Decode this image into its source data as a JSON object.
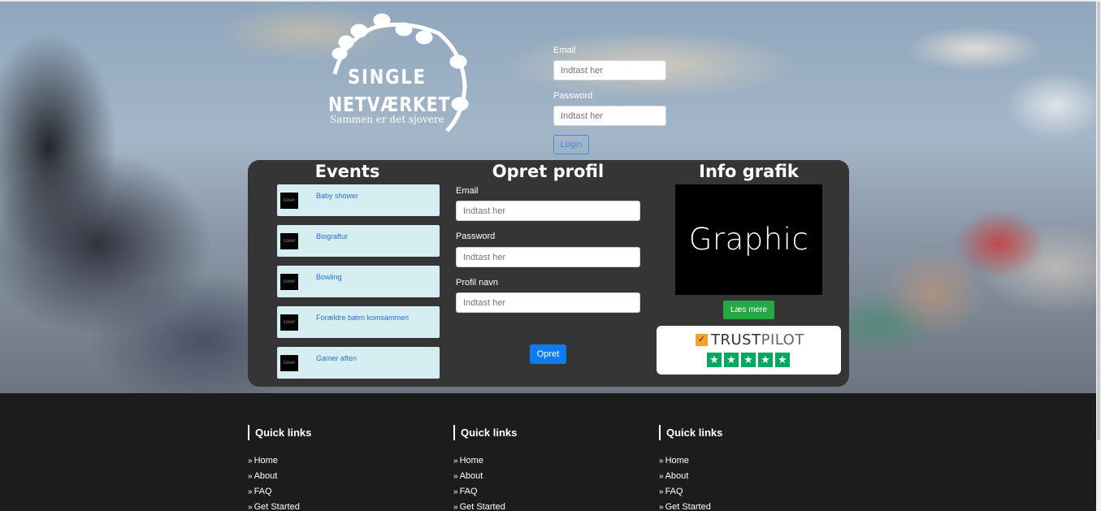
{
  "logo": {
    "line1": "SINGLE",
    "line2": "NETVÆRKET",
    "tagline": "Sammen er det sjovere"
  },
  "login": {
    "email_label": "Email",
    "email_placeholder": "Indtast her",
    "password_label": "Password",
    "password_placeholder": "Indtast her",
    "login_label": "Login"
  },
  "events": {
    "title": "Events",
    "items": [
      {
        "cover": "cover",
        "label": "Baby shower"
      },
      {
        "cover": "cover",
        "label": "Biograftur"
      },
      {
        "cover": "cover",
        "label": "Bowling"
      },
      {
        "cover": "cover",
        "label": "Forældre bærn komsammen"
      },
      {
        "cover": "cover",
        "label": "Gamer aften"
      }
    ]
  },
  "register": {
    "title": "Opret profil",
    "email_label": "Email",
    "email_placeholder": "Indtast her",
    "password_label": "Password",
    "password_placeholder": "Indtast her",
    "profile_label": "Profil navn",
    "profile_placeholder": "Indtast her",
    "submit_label": "Opret"
  },
  "info": {
    "title": "Info grafik",
    "graphic_text": "Graphic",
    "read_more_label": "Læs mere",
    "trustpilot_bold": "TRUST",
    "trustpilot_light": "PILOT",
    "stars": 5
  },
  "footer": {
    "columns": [
      {
        "heading": "Quick links",
        "links": [
          "Home",
          "About",
          "FAQ",
          "Get Started"
        ]
      },
      {
        "heading": "Quick links",
        "links": [
          "Home",
          "About",
          "FAQ",
          "Get Started"
        ]
      },
      {
        "heading": "Quick links",
        "links": [
          "Home",
          "About",
          "FAQ",
          "Get Started"
        ]
      }
    ]
  },
  "colors": {
    "panel": "#353535",
    "event_bg": "#d6edf2",
    "link_blue": "#2574c9",
    "primary": "#0d7cf2",
    "success": "#28a745",
    "trustpilot_green": "#00a862",
    "footer_bg": "#1c1c1c"
  }
}
